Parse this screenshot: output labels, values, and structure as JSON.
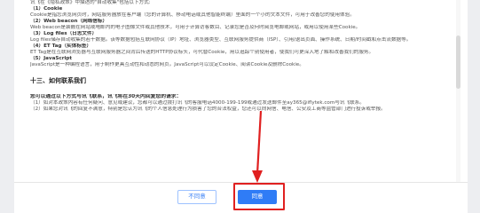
{
  "content": {
    "intro": "讯飞在《隐私政策》中描述的\"自动收集\"包括以下方式:",
    "items": [
      {
        "title": "（1）Cookie",
        "text": "Cookie是指您浏览网页时，网站服务器放在客户端（您的计算机、移动电话或其他智能终端）里面的一个小的文本文件，可用于改善您的使用体验。"
      },
      {
        "title": "（2）Web beacon（网络信标）",
        "text": "Web beacon是装嵌在网站或电邮内的电子图像文件或其他技术，可用于计算访客数目、记录您是否及何时阅览电邮或网站，或用以使用某些Cookie。"
      },
      {
        "title": "（3）Log files（日志文件）",
        "text": "Log files储存自动收集的若干数据。该等数据包括互联网协议（IP）地址、浏览器类型、互联网服务提供商（ISP）、引用/退出页面、操作系统、日期/时间戳和点击流数据等。"
      },
      {
        "title": "（4）ET Tag（实体标签）",
        "text": "ET Tag是在互联网浏览器与互联网服务器之间背后传送的HTTP协议标头，可代替Cookie，用以追踪个别使用者，使我们可更深入地了解和改善我们的服务。"
      },
      {
        "title": "（5）JavaScript",
        "text": "JavaScript是一种编程语言，用于制作更具互动性和动态的网页。JavaScript可以设定Cookie、阅读Cookie及删除Cookie。"
      }
    ],
    "section_13": "十三、如何联系我们",
    "contact_lead": "您可以通过以下方式与讯飞联系，讯飞将在30天内回复您的请求：",
    "contact_items": [
      "（1）如对本政策内容有任何疑问、意见或建议，您都可以通过拨打讯飞的客服电话4000-199-199或通过发送邮件至ay365@iflytek.com与讯飞联系。",
      "（2）如果您对讯飞的回复不满意，特别是您认为讯飞的个人信息处理行为损害了您的合法权益，您还可以向网信、电信、公安及工商等监管部门进行投诉或举报。"
    ]
  },
  "footer": {
    "disagree_label": "不同意",
    "agree_label": "同意"
  },
  "colors": {
    "primary": "#2f7cf6",
    "annotation": "#e02020"
  }
}
